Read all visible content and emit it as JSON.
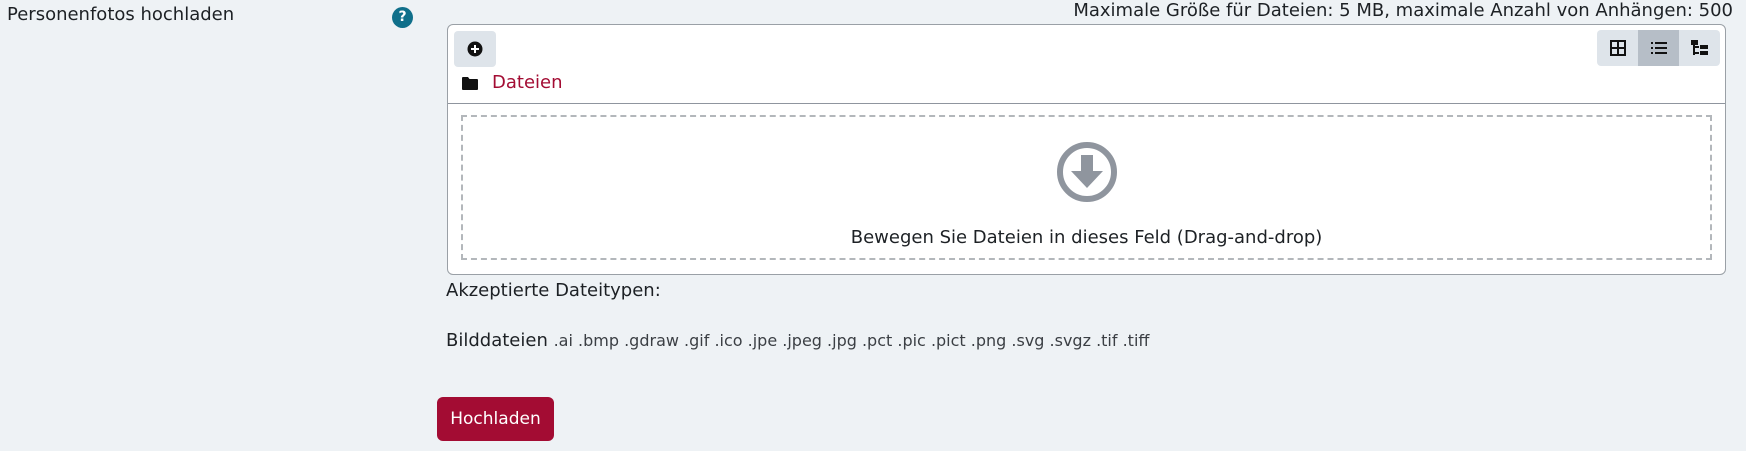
{
  "field": {
    "label": "Personenfotos hochladen",
    "help_glyph": "?"
  },
  "limits": {
    "text": "Maximale Größe für Dateien: 5 MB, maximale Anzahl von Anhängen: 500"
  },
  "filemanager": {
    "add_icon": "plus-circle-icon",
    "view_modes": [
      {
        "icon": "grid-view-icon",
        "active": false
      },
      {
        "icon": "list-view-icon",
        "active": true
      },
      {
        "icon": "tree-view-icon",
        "active": false
      }
    ],
    "path": {
      "folder_icon": "folder-icon",
      "label": "Dateien"
    },
    "dropzone": {
      "icon": "download-arrow-icon",
      "text": "Bewegen Sie Dateien in dieses Feld (Drag-and-drop)"
    }
  },
  "accepted": {
    "label": "Akzeptierte Dateitypen:",
    "group_name": "Bilddateien",
    "extensions": ".ai .bmp .gdraw .gif .ico .jpe .jpeg .jpg .pct .pic .pict .png .svg .svgz .tif .tiff"
  },
  "actions": {
    "upload_label": "Hochladen"
  },
  "colors": {
    "accent": "#a30c33",
    "help": "#0f6f8a",
    "background": "#eef2f5"
  }
}
